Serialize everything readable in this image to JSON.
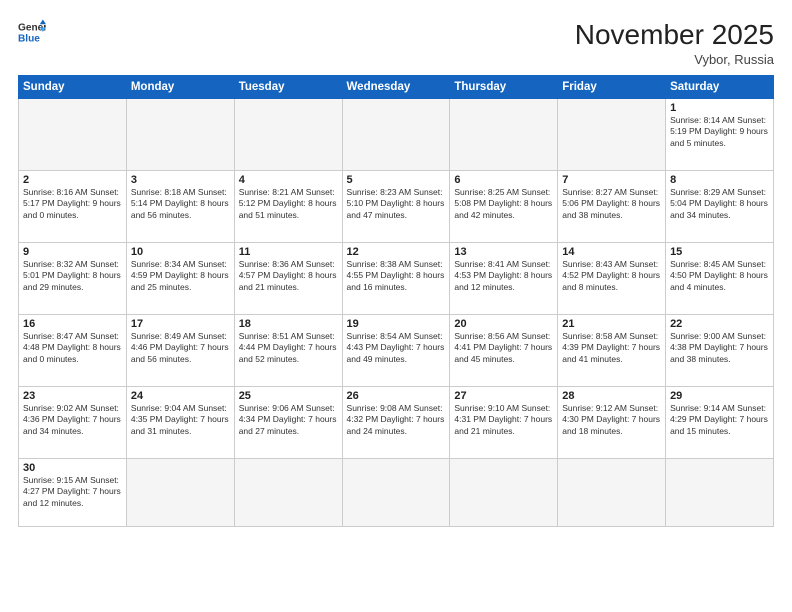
{
  "logo": {
    "line1": "General",
    "line2": "Blue"
  },
  "header": {
    "month_year": "November 2025",
    "location": "Vybor, Russia"
  },
  "weekdays": [
    "Sunday",
    "Monday",
    "Tuesday",
    "Wednesday",
    "Thursday",
    "Friday",
    "Saturday"
  ],
  "weeks": [
    [
      {
        "day": "",
        "info": ""
      },
      {
        "day": "",
        "info": ""
      },
      {
        "day": "",
        "info": ""
      },
      {
        "day": "",
        "info": ""
      },
      {
        "day": "",
        "info": ""
      },
      {
        "day": "",
        "info": ""
      },
      {
        "day": "1",
        "info": "Sunrise: 8:14 AM\nSunset: 5:19 PM\nDaylight: 9 hours and 5 minutes."
      }
    ],
    [
      {
        "day": "2",
        "info": "Sunrise: 8:16 AM\nSunset: 5:17 PM\nDaylight: 9 hours and 0 minutes."
      },
      {
        "day": "3",
        "info": "Sunrise: 8:18 AM\nSunset: 5:14 PM\nDaylight: 8 hours and 56 minutes."
      },
      {
        "day": "4",
        "info": "Sunrise: 8:21 AM\nSunset: 5:12 PM\nDaylight: 8 hours and 51 minutes."
      },
      {
        "day": "5",
        "info": "Sunrise: 8:23 AM\nSunset: 5:10 PM\nDaylight: 8 hours and 47 minutes."
      },
      {
        "day": "6",
        "info": "Sunrise: 8:25 AM\nSunset: 5:08 PM\nDaylight: 8 hours and 42 minutes."
      },
      {
        "day": "7",
        "info": "Sunrise: 8:27 AM\nSunset: 5:06 PM\nDaylight: 8 hours and 38 minutes."
      },
      {
        "day": "8",
        "info": "Sunrise: 8:29 AM\nSunset: 5:04 PM\nDaylight: 8 hours and 34 minutes."
      }
    ],
    [
      {
        "day": "9",
        "info": "Sunrise: 8:32 AM\nSunset: 5:01 PM\nDaylight: 8 hours and 29 minutes."
      },
      {
        "day": "10",
        "info": "Sunrise: 8:34 AM\nSunset: 4:59 PM\nDaylight: 8 hours and 25 minutes."
      },
      {
        "day": "11",
        "info": "Sunrise: 8:36 AM\nSunset: 4:57 PM\nDaylight: 8 hours and 21 minutes."
      },
      {
        "day": "12",
        "info": "Sunrise: 8:38 AM\nSunset: 4:55 PM\nDaylight: 8 hours and 16 minutes."
      },
      {
        "day": "13",
        "info": "Sunrise: 8:41 AM\nSunset: 4:53 PM\nDaylight: 8 hours and 12 minutes."
      },
      {
        "day": "14",
        "info": "Sunrise: 8:43 AM\nSunset: 4:52 PM\nDaylight: 8 hours and 8 minutes."
      },
      {
        "day": "15",
        "info": "Sunrise: 8:45 AM\nSunset: 4:50 PM\nDaylight: 8 hours and 4 minutes."
      }
    ],
    [
      {
        "day": "16",
        "info": "Sunrise: 8:47 AM\nSunset: 4:48 PM\nDaylight: 8 hours and 0 minutes."
      },
      {
        "day": "17",
        "info": "Sunrise: 8:49 AM\nSunset: 4:46 PM\nDaylight: 7 hours and 56 minutes."
      },
      {
        "day": "18",
        "info": "Sunrise: 8:51 AM\nSunset: 4:44 PM\nDaylight: 7 hours and 52 minutes."
      },
      {
        "day": "19",
        "info": "Sunrise: 8:54 AM\nSunset: 4:43 PM\nDaylight: 7 hours and 49 minutes."
      },
      {
        "day": "20",
        "info": "Sunrise: 8:56 AM\nSunset: 4:41 PM\nDaylight: 7 hours and 45 minutes."
      },
      {
        "day": "21",
        "info": "Sunrise: 8:58 AM\nSunset: 4:39 PM\nDaylight: 7 hours and 41 minutes."
      },
      {
        "day": "22",
        "info": "Sunrise: 9:00 AM\nSunset: 4:38 PM\nDaylight: 7 hours and 38 minutes."
      }
    ],
    [
      {
        "day": "23",
        "info": "Sunrise: 9:02 AM\nSunset: 4:36 PM\nDaylight: 7 hours and 34 minutes."
      },
      {
        "day": "24",
        "info": "Sunrise: 9:04 AM\nSunset: 4:35 PM\nDaylight: 7 hours and 31 minutes."
      },
      {
        "day": "25",
        "info": "Sunrise: 9:06 AM\nSunset: 4:34 PM\nDaylight: 7 hours and 27 minutes."
      },
      {
        "day": "26",
        "info": "Sunrise: 9:08 AM\nSunset: 4:32 PM\nDaylight: 7 hours and 24 minutes."
      },
      {
        "day": "27",
        "info": "Sunrise: 9:10 AM\nSunset: 4:31 PM\nDaylight: 7 hours and 21 minutes."
      },
      {
        "day": "28",
        "info": "Sunrise: 9:12 AM\nSunset: 4:30 PM\nDaylight: 7 hours and 18 minutes."
      },
      {
        "day": "29",
        "info": "Sunrise: 9:14 AM\nSunset: 4:29 PM\nDaylight: 7 hours and 15 minutes."
      }
    ],
    [
      {
        "day": "30",
        "info": "Sunrise: 9:15 AM\nSunset: 4:27 PM\nDaylight: 7 hours and 12 minutes."
      },
      {
        "day": "",
        "info": ""
      },
      {
        "day": "",
        "info": ""
      },
      {
        "day": "",
        "info": ""
      },
      {
        "day": "",
        "info": ""
      },
      {
        "day": "",
        "info": ""
      },
      {
        "day": "",
        "info": ""
      }
    ]
  ]
}
